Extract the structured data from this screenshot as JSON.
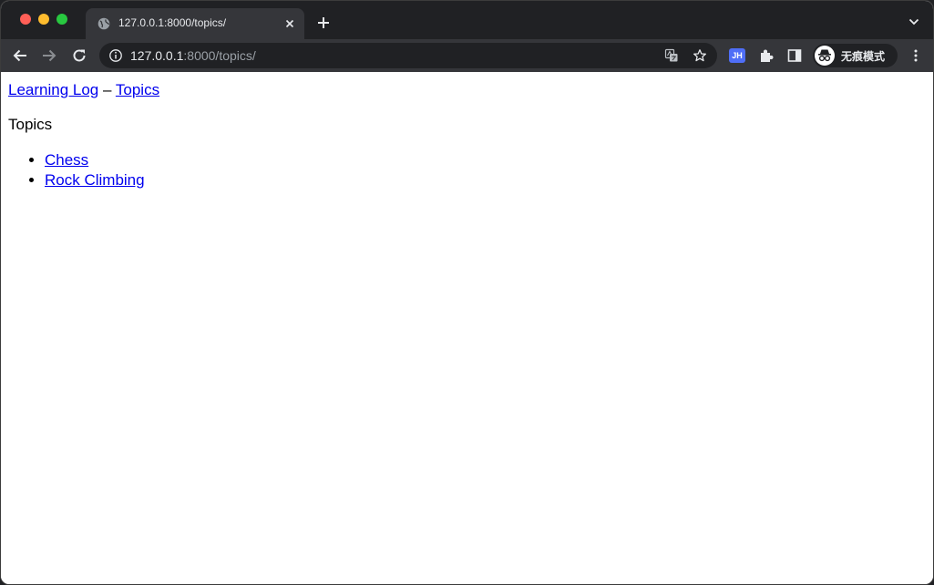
{
  "browser": {
    "tab_title": "127.0.0.1:8000/topics/",
    "url_host": "127.0.0.1",
    "url_rest": ":8000/topics/",
    "extension_label": "JH",
    "profile_label": "无痕模式"
  },
  "page": {
    "nav": {
      "home_link": "Learning Log",
      "separator": "–",
      "topics_link": "Topics"
    },
    "heading": "Topics",
    "topics": [
      {
        "label": "Chess"
      },
      {
        "label": "Rock Climbing"
      }
    ]
  },
  "colors": {
    "chrome_dark": "#202124",
    "chrome_toolbar": "#35363a",
    "link": "#0000ee",
    "traffic_red": "#ff5f57",
    "traffic_yellow": "#febc2e",
    "traffic_green": "#28c840"
  },
  "icons": [
    "globe-icon",
    "close-icon",
    "plus-icon",
    "chevron-down-icon",
    "back-arrow-icon",
    "forward-arrow-icon",
    "reload-icon",
    "info-icon",
    "translate-icon",
    "star-icon",
    "puzzle-icon",
    "side-panel-icon",
    "incognito-icon",
    "more-vert-icon"
  ]
}
